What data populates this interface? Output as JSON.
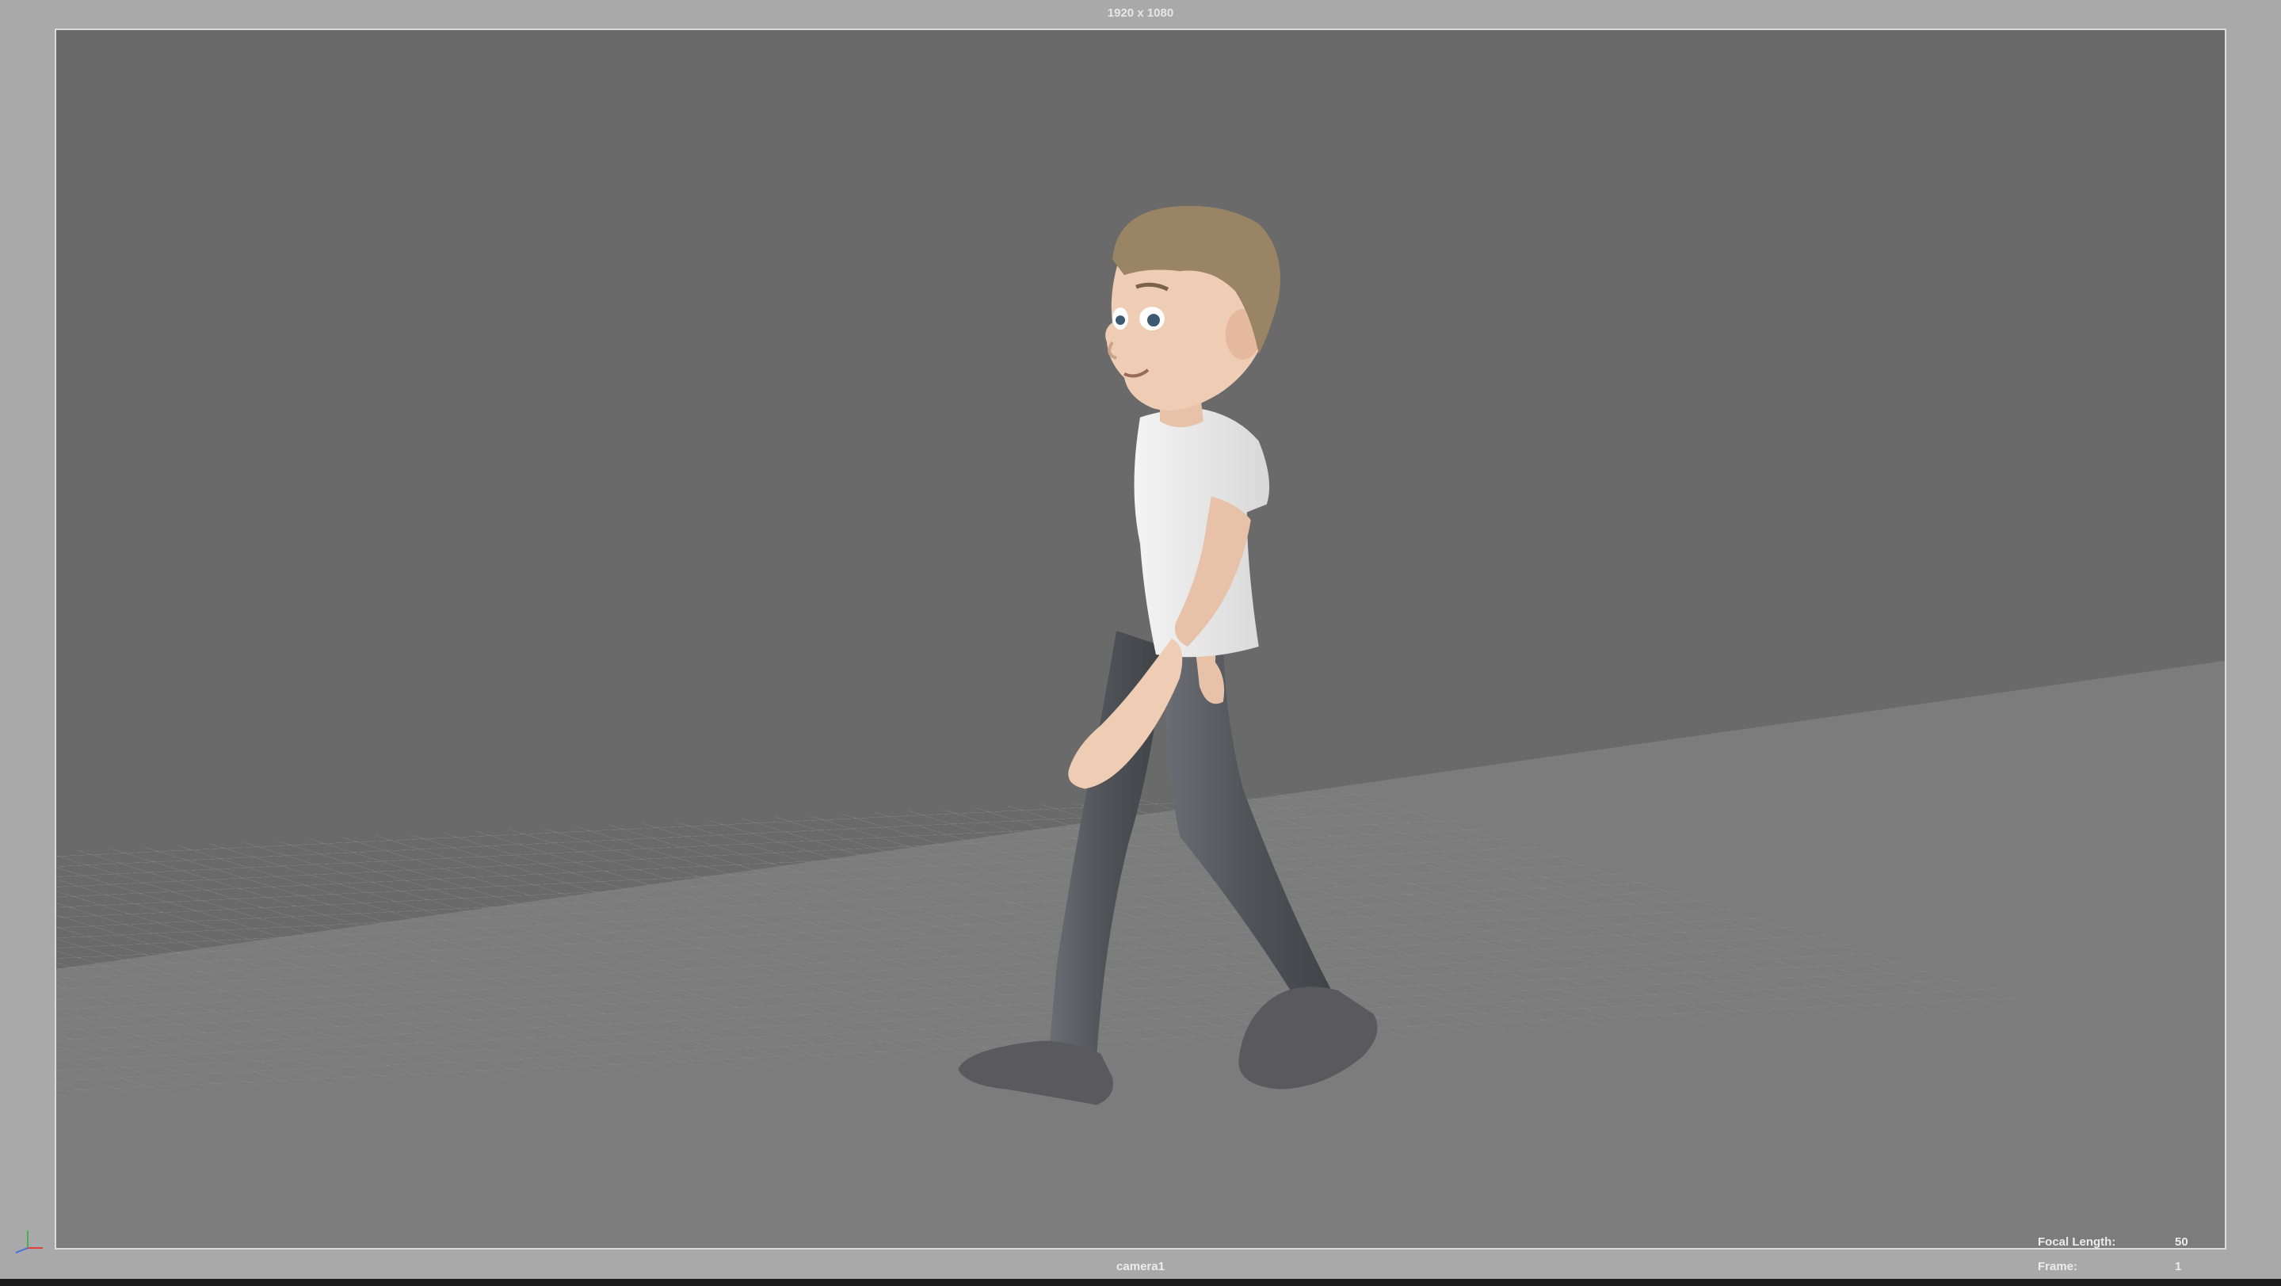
{
  "viewport": {
    "resolution": "1920 x 1080",
    "camera": "camera1",
    "hud": {
      "focal_length_label": "Focal Length:",
      "focal_length_value": "50",
      "frame_label": "Frame:",
      "frame_value": "1"
    }
  },
  "icons": {
    "axis_indicator": "xyz-axis-icon"
  },
  "colors": {
    "background": "#a9a9a9",
    "wall": "#6a6a6a",
    "floor": "#7c7c7c",
    "gate_border": "#dcdcdc",
    "hud_text": "#ececec"
  }
}
